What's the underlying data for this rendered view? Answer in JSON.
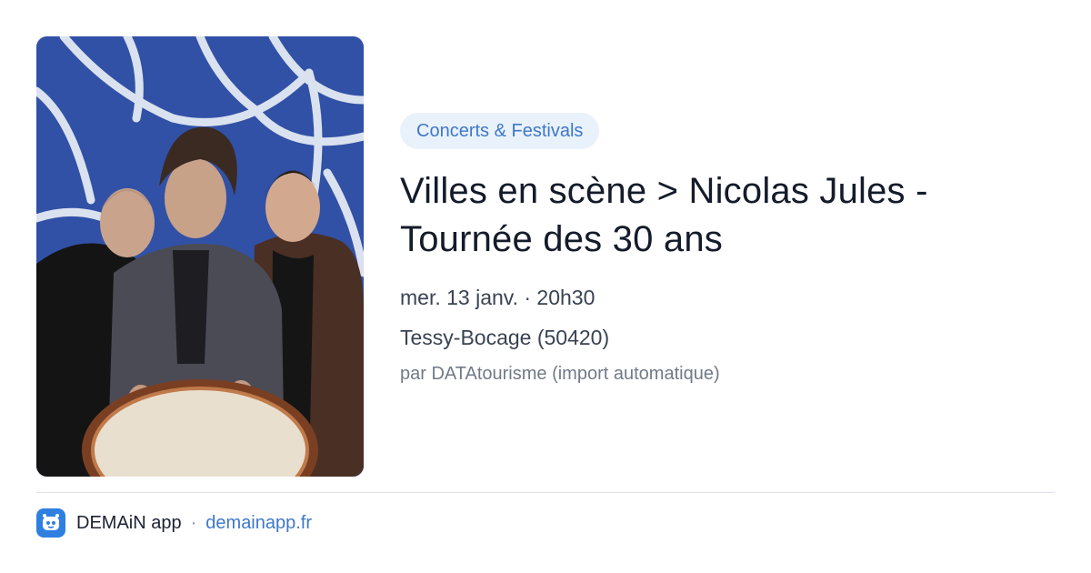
{
  "event": {
    "category": "Concerts & Festivals",
    "title_line1": "Villes en scène > Nicolas Jules -",
    "title_line2": "Tournée des 30 ans",
    "datetime": "mer. 13 janv. · 20h30",
    "location": "Tessy-Bocage (50420)",
    "source": "par DATAtourisme (import automatique)"
  },
  "image": {
    "subject": "band-photo"
  },
  "footer": {
    "app_icon": "demain-app-icon",
    "app_name": "DEMAiN app",
    "separator": "·",
    "url": "demainapp.fr"
  },
  "colors": {
    "accent": "#3f78c9",
    "badge_bg": "#e9f1fb",
    "app_icon_bg": "#2f7fe0"
  }
}
